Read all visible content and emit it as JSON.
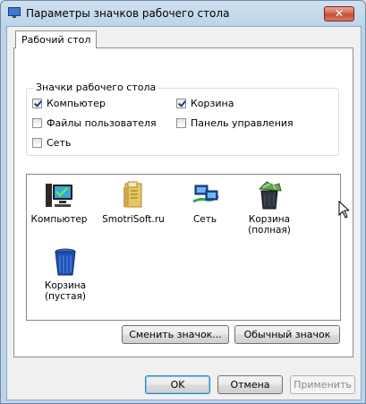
{
  "window": {
    "title": "Параметры значков рабочего стола",
    "close_label": "✕"
  },
  "tabs": [
    {
      "label": "Рабочий стол"
    }
  ],
  "desktop_icons_group": {
    "label": "Значки рабочего стола",
    "checkboxes": [
      {
        "label": "Компьютер",
        "checked": true
      },
      {
        "label": "Корзина",
        "checked": true
      },
      {
        "label": "Файлы пользователя",
        "checked": false
      },
      {
        "label": "Панель управления",
        "checked": false
      },
      {
        "label": "Сеть",
        "checked": false
      }
    ]
  },
  "icon_list": {
    "items": [
      {
        "label": "Компьютер",
        "icon": "computer-icon"
      },
      {
        "label": "SmotriSoft.ru",
        "icon": "user-files-icon"
      },
      {
        "label": "Сеть",
        "icon": "network-icon"
      },
      {
        "label": "Корзина (полная)",
        "icon": "recycle-bin-full-icon"
      },
      {
        "label": "Корзина (пустая)",
        "icon": "recycle-bin-empty-icon"
      }
    ]
  },
  "buttons": {
    "change_icon": "Сменить значок...",
    "default_icon": "Обычный значок",
    "ok": "OK",
    "cancel": "Отмена",
    "apply": "Применить"
  }
}
